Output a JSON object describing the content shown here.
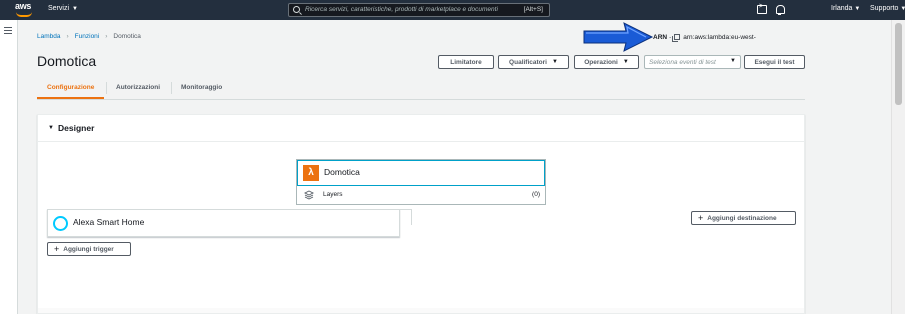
{
  "topnav": {
    "logo_text": "aws",
    "services_label": "Servizi",
    "search_placeholder": "Ricerca servizi, caratteristiche, prodotti di marketplace e documenti",
    "search_shortcut": "[Alt+S]",
    "region_label": "Irlanda",
    "support_label": "Supporto"
  },
  "breadcrumb": {
    "items": [
      "Lambda",
      "Funzioni",
      "Domotica"
    ]
  },
  "arn": {
    "label": "ARN",
    "separator": "-",
    "value": "arn:aws:lambda:eu-west-"
  },
  "header": {
    "title": "Domotica",
    "throttle_label": "Limitatore",
    "qualifiers_label": "Qualificatori",
    "actions_label": "Operazioni",
    "test_event_placeholder": "Seleziona eventi di test",
    "test_label": "Esegui il test"
  },
  "tabs": [
    {
      "label": "Configurazione"
    },
    {
      "label": "Autorizzazioni"
    },
    {
      "label": "Monitoraggio"
    }
  ],
  "designer": {
    "title": "Designer",
    "function_name": "Domotica",
    "layers_label": "Layers",
    "layers_count": "(0)",
    "trigger_name": "Alexa Smart Home",
    "add_trigger_label": "Aggiungi trigger",
    "add_destination_label": "Aggiungi destinazione"
  },
  "colors": {
    "nav_bg": "#232f3e",
    "accent_orange": "#ec7211",
    "link_blue": "#0073bb",
    "alexa_cyan": "#00caff",
    "arrow_blue": "#1a5bd6"
  }
}
